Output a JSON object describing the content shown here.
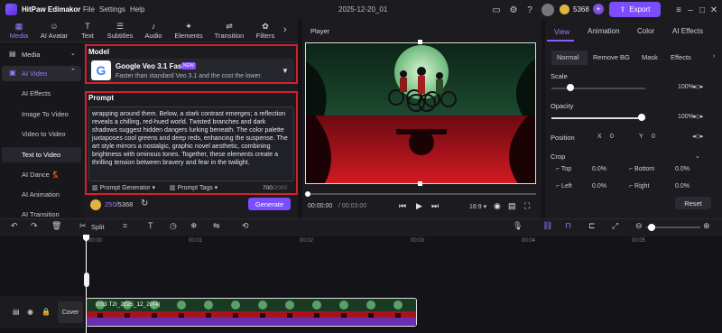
{
  "titlebar": {
    "app_name": "HitPaw Edimakor",
    "menus": [
      "File",
      "Settings",
      "Help"
    ],
    "project": "2025-12-20_01",
    "credits": "5368",
    "export_label": "Export",
    "plus": "+"
  },
  "left_tabs": [
    {
      "label": "Media",
      "icon": "media-icon"
    },
    {
      "label": "AI Avatar",
      "icon": "avatar-icon"
    },
    {
      "label": "Text",
      "icon": "text-icon"
    },
    {
      "label": "Subtitles",
      "icon": "subtitles-icon"
    },
    {
      "label": "Audio",
      "icon": "audio-icon"
    },
    {
      "label": "Elements",
      "icon": "elements-icon"
    },
    {
      "label": "Transition",
      "icon": "transition-icon"
    },
    {
      "label": "Filters",
      "icon": "filters-icon"
    }
  ],
  "nav": {
    "media": "Media",
    "ai_video": "AI Video",
    "items": [
      "AI Effects",
      "Image To Video",
      "Video to Video",
      "Text to Video",
      "AI Dance 💃",
      "AI Animation",
      "AI Transition"
    ]
  },
  "model": {
    "section_label": "Model",
    "name": "Google Veo 3.1 Fast",
    "badge": "NEW",
    "description": "Faster than standard Veo 3.1 and the cost the lower."
  },
  "prompt": {
    "section_label": "Prompt",
    "text": "wrapping around them. Below, a stark contrast emerges; a reflection reveals a chilling, red-hued world. Twisted branches and dark shadows suggest hidden dangers lurking beneath. The color palette juxtaposes cool greens and deep reds, enhancing the suspense. The art style mirrors a nostalgic, graphic novel aesthetic, combining brightness with ominous tones. Together, these elements create a thrilling tension between bravery and fear in the twilight.",
    "generator_label": "Prompt Generator",
    "tags_label": "Prompt Tags",
    "count": "700",
    "max": "/2000",
    "credit_used": "250",
    "credit_total": "/5368",
    "generate_label": "Generate"
  },
  "player": {
    "label": "Player",
    "time_current": "00:00:00",
    "time_total": "/ 00:03:00",
    "ratio": "16:9"
  },
  "right_tabs": [
    "View",
    "Animation",
    "Color",
    "AI Effects"
  ],
  "right_subtabs": [
    "Normal",
    "Remove BG",
    "Mask",
    "Effects"
  ],
  "props": {
    "scale": {
      "label": "Scale",
      "value": "100%",
      "level": 1.0
    },
    "opacity": {
      "label": "Opacity",
      "value": "100%",
      "level": 1.0
    },
    "position": {
      "label": "Position",
      "x_label": "X",
      "x": "0",
      "y_label": "Y",
      "y": "0"
    },
    "crop": {
      "label": "Crop",
      "top": "Top",
      "top_v": "0.0%",
      "bottom": "Bottom",
      "bottom_v": "0.0%",
      "left": "Left",
      "left_v": "0.0%",
      "right": "Right",
      "right_v": "0.0%"
    },
    "reset": "Reset"
  },
  "timeline": {
    "split_label": "Split",
    "ticks": [
      "00:00",
      "00:01",
      "00:02",
      "00:03",
      "00:04",
      "00:05"
    ],
    "cover_label": "Cover",
    "clip_label": "0:03  T2I_2025_12_20(4)"
  },
  "colors": {
    "accent": "#7c4dff",
    "highlight": "#d4202c"
  }
}
